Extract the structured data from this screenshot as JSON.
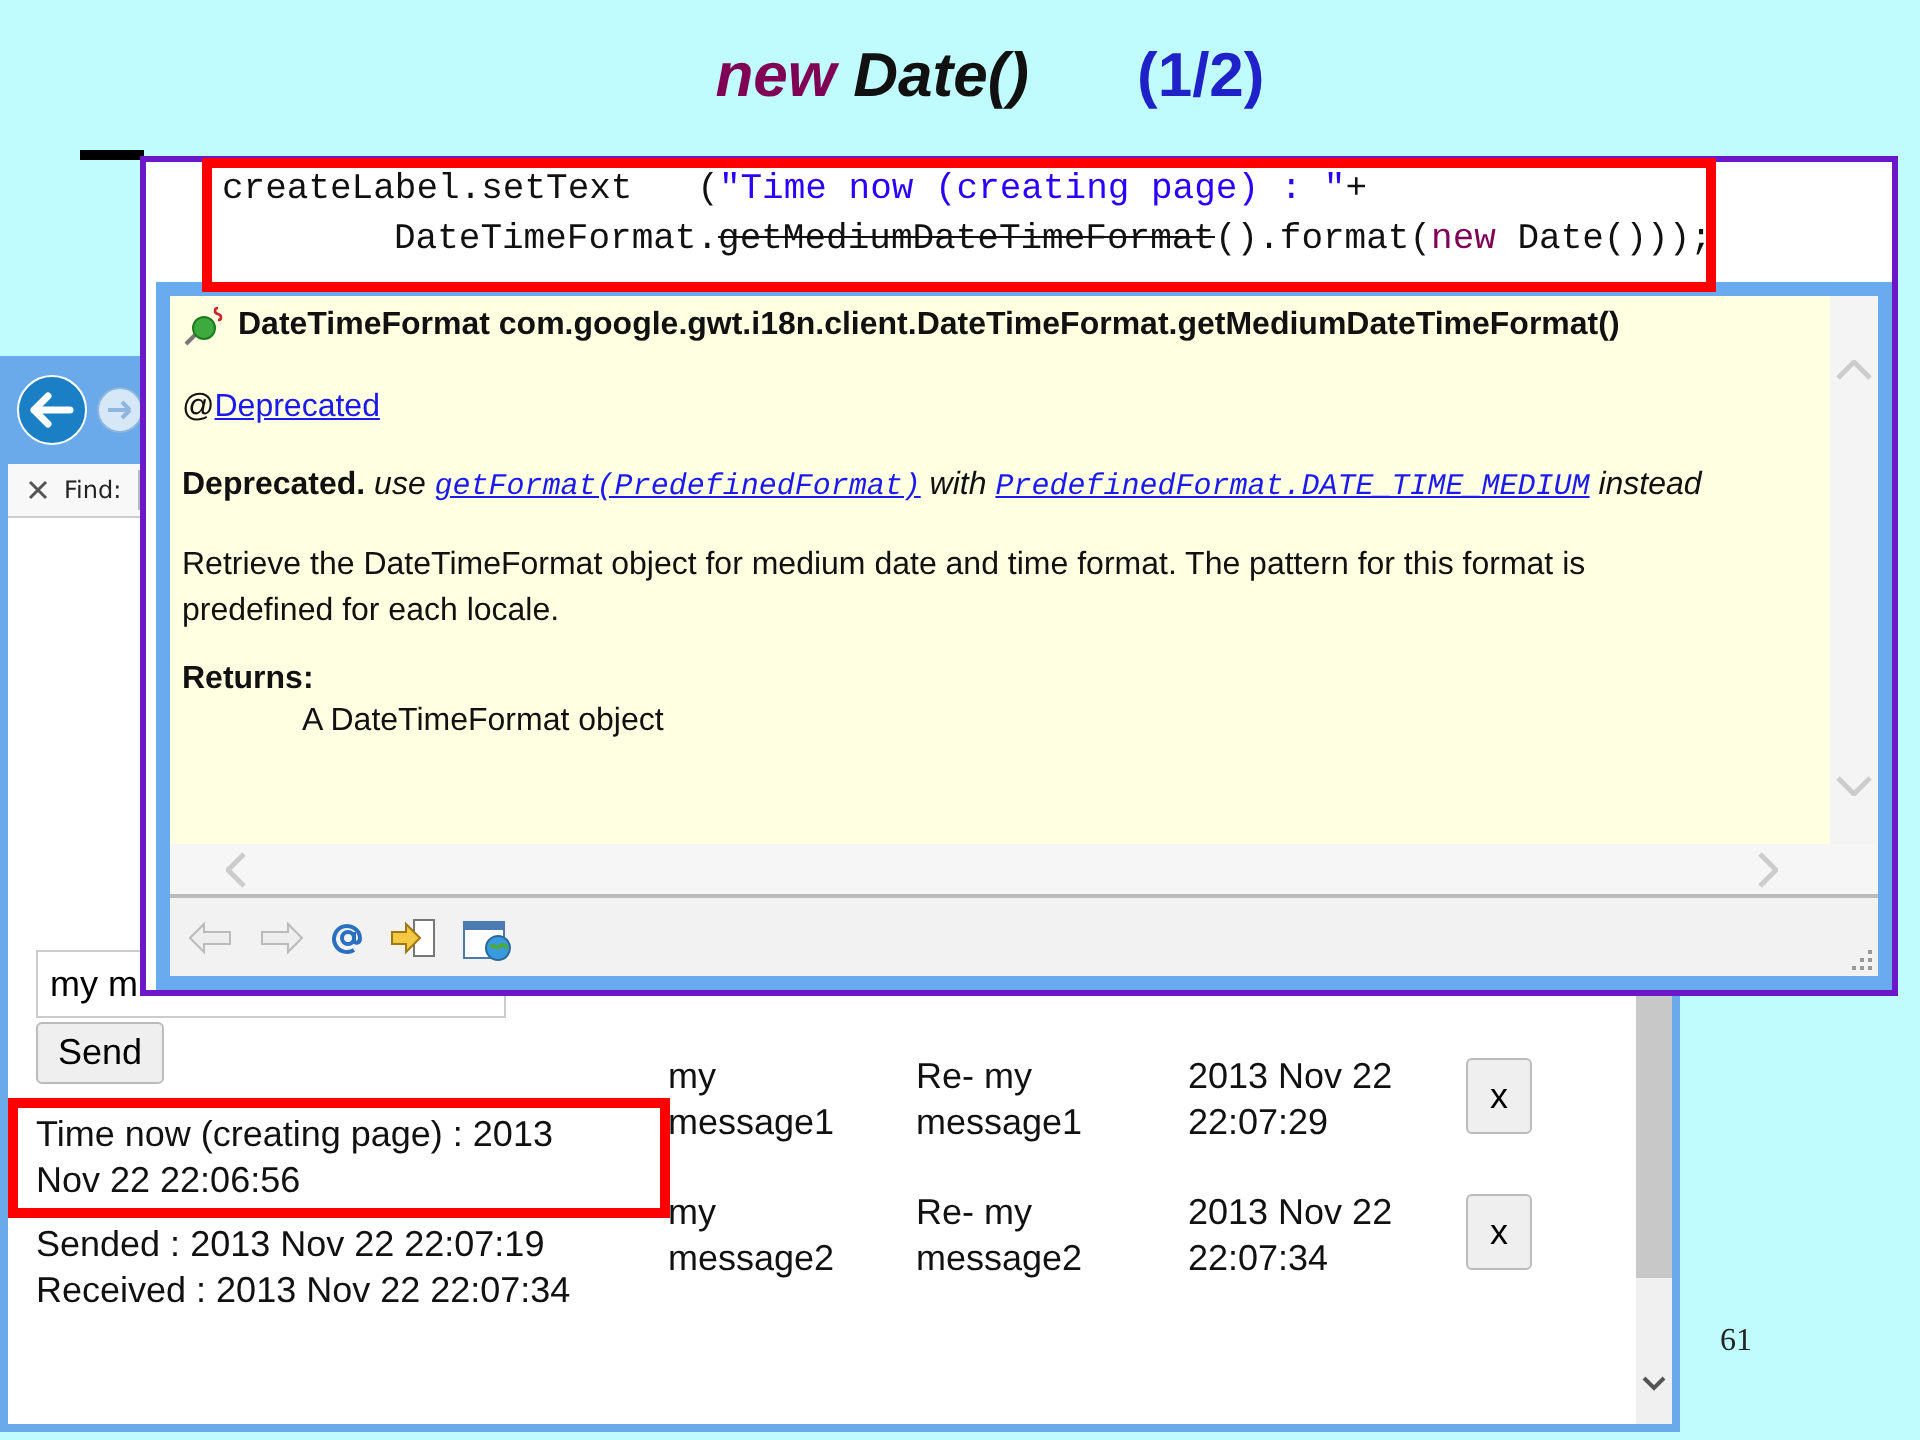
{
  "slide": {
    "title": {
      "keyword": "new",
      "name": "Date()",
      "counter": "(1/2)"
    },
    "page_number": "61"
  },
  "browser": {
    "find_label": "Find:",
    "message_field": {
      "value": "my m"
    },
    "send_button": "Send",
    "creation_time": "Time now (creating page) : 2013 Nov 22 22:06:56",
    "sent_time": "Sended : 2013 Nov 22 22:07:19",
    "received_time": "Received : 2013 Nov 22 22:07:34",
    "rows": [
      {
        "send": "my message1",
        "receive": "Re- my message1",
        "time": "2013 Nov 22 22:07:29",
        "delete": "x"
      },
      {
        "send": "my message2",
        "receive": "Re- my message2",
        "time": "2013 Nov 22 22:07:34",
        "delete": "x"
      }
    ]
  },
  "editor": {
    "code_lines": [
      {
        "indented": false,
        "tokens": [
          {
            "kind": "plain",
            "text": "createLabel.setText   ("
          },
          {
            "kind": "string",
            "text": "\"Time now (creating page) : \""
          },
          {
            "kind": "plain",
            "text": "+"
          }
        ]
      },
      {
        "indented": true,
        "tokens": [
          {
            "kind": "plain",
            "text": "DateTimeFormat."
          },
          {
            "kind": "deprecated",
            "text": "getMediumDateTimeFormat"
          },
          {
            "kind": "plain",
            "text": "().format("
          },
          {
            "kind": "keyword",
            "text": "new"
          },
          {
            "kind": "plain",
            "text": " Date()));"
          }
        ]
      }
    ],
    "javadoc": {
      "signature": "DateTimeFormat com.google.gwt.i18n.client.DateTimeFormat.getMediumDateTimeFormat()",
      "annotation": {
        "prefix": "@",
        "link": "Deprecated"
      },
      "deprecation": [
        {
          "kind": "bold",
          "text": "Deprecated."
        },
        {
          "kind": "italic",
          "text": "use"
        },
        {
          "kind": "link",
          "text": "getFormat(PredefinedFormat)"
        },
        {
          "kind": "italic",
          "text": "with"
        },
        {
          "kind": "link",
          "text": "PredefinedFormat.DATE_TIME_MEDIUM"
        },
        {
          "kind": "italic",
          "text": "instead"
        }
      ],
      "description": "Retrieve the DateTimeFormat object for medium date and time format. The pattern for this format is predefined for each locale.",
      "returns_label": "Returns:",
      "returns_text": "A DateTimeFormat object"
    }
  }
}
